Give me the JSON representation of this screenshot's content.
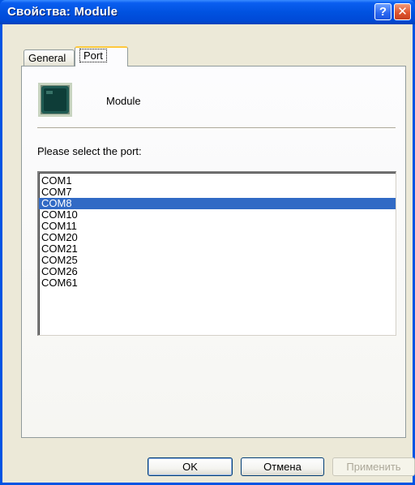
{
  "window": {
    "title": "Свойства: Module",
    "help_glyph": "?",
    "close_glyph": "✕"
  },
  "tabs": [
    {
      "label": "General",
      "active": false
    },
    {
      "label": "Port",
      "active": true
    }
  ],
  "device": {
    "icon": "chip-icon",
    "name": "Module"
  },
  "port_section": {
    "prompt": "Please select the port:",
    "ports": [
      "COM1",
      "COM7",
      "COM8",
      "COM10",
      "COM11",
      "COM20",
      "COM21",
      "COM25",
      "COM26",
      "COM61"
    ],
    "selected": "COM8"
  },
  "buttons": {
    "ok": "OK",
    "cancel": "Отмена",
    "apply": "Применить"
  },
  "colors": {
    "title_bar": "#0054e3",
    "selection": "#316ac5",
    "dialog_face": "#ece9d8"
  }
}
